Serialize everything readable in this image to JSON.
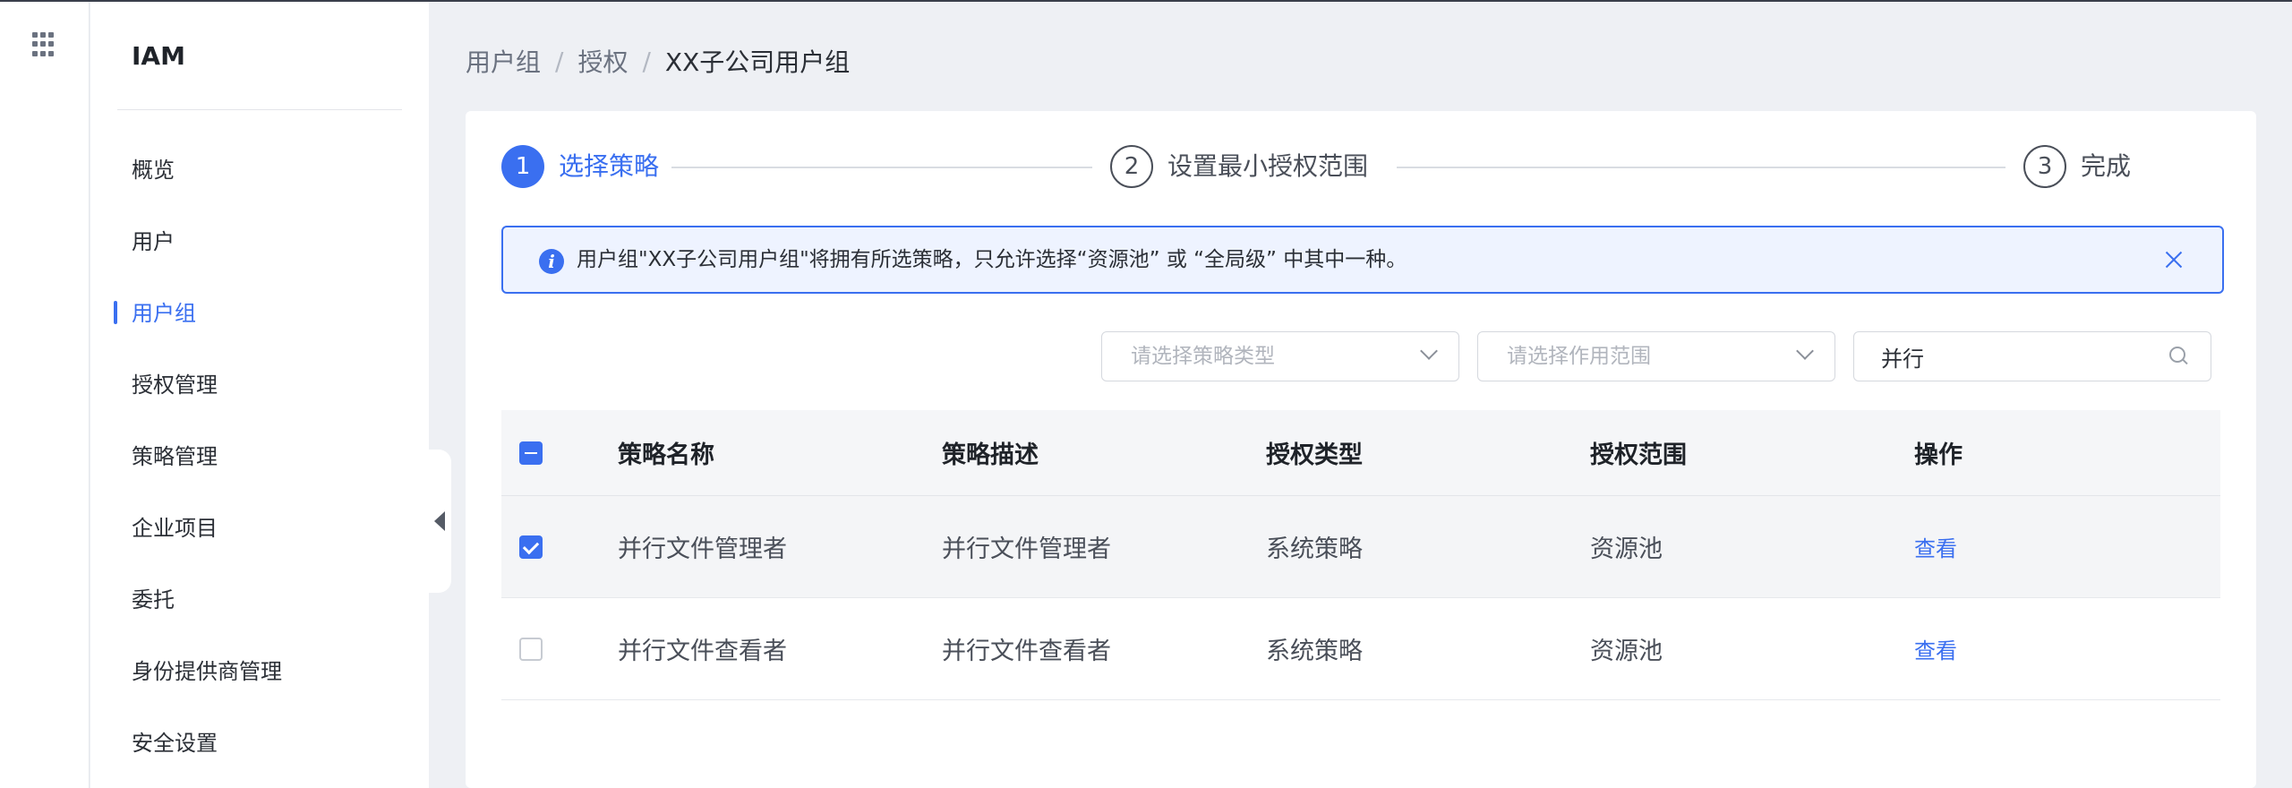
{
  "app": {
    "brand": "IAM"
  },
  "sidebar": {
    "items": [
      {
        "label": "概览"
      },
      {
        "label": "用户"
      },
      {
        "label": "用户组"
      },
      {
        "label": "授权管理"
      },
      {
        "label": "策略管理"
      },
      {
        "label": "企业项目"
      },
      {
        "label": "委托"
      },
      {
        "label": "身份提供商管理"
      },
      {
        "label": "安全设置"
      }
    ],
    "active_index": 2
  },
  "breadcrumb": {
    "items": [
      "用户组",
      "授权",
      "XX子公司用户组"
    ],
    "separator": "/"
  },
  "steps": [
    {
      "num": "1",
      "label": "选择策略",
      "state": "active"
    },
    {
      "num": "2",
      "label": "设置最小授权范围",
      "state": "idle"
    },
    {
      "num": "3",
      "label": "完成",
      "state": "idle"
    }
  ],
  "alert": {
    "icon": "info-icon",
    "text": "用户组\"XX子公司用户组\"将拥有所选策略，只允许选择“资源池” 或 “全局级” 中其中一种。"
  },
  "filters": {
    "policy_type_placeholder": "请选择策略类型",
    "scope_placeholder": "请选择作用范围",
    "search_value": "并行"
  },
  "table": {
    "columns": [
      "策略名称",
      "策略描述",
      "授权类型",
      "授权范围",
      "操作"
    ],
    "rows": [
      {
        "checked": true,
        "name": "并行文件管理者",
        "desc": "并行文件管理者",
        "type": "系统策略",
        "scope": "资源池",
        "action": "查看"
      },
      {
        "checked": false,
        "name": "并行文件查看者",
        "desc": "并行文件查看者",
        "type": "系统策略",
        "scope": "资源池",
        "action": "查看"
      }
    ]
  },
  "colors": {
    "accent": "#3a6ff0",
    "alert_bg": "#eef3ff",
    "page_bg": "#eef0f4"
  }
}
